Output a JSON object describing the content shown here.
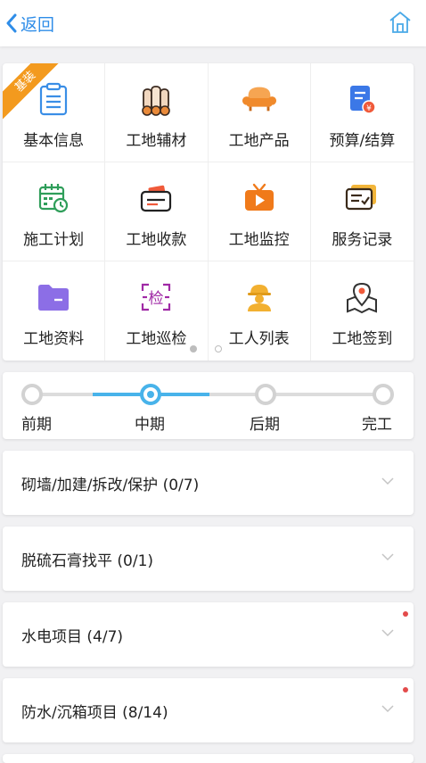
{
  "header": {
    "back_label": "返回"
  },
  "grid": {
    "badge": "基装",
    "items": [
      {
        "label": "基本信息",
        "icon": "document-list-icon"
      },
      {
        "label": "工地辅材",
        "icon": "material-rolls-icon"
      },
      {
        "label": "工地产品",
        "icon": "sofa-icon"
      },
      {
        "label": "预算/结算",
        "icon": "budget-icon"
      },
      {
        "label": "施工计划",
        "icon": "calendar-clock-icon"
      },
      {
        "label": "工地收款",
        "icon": "wallet-icon"
      },
      {
        "label": "工地监控",
        "icon": "tv-play-icon"
      },
      {
        "label": "服务记录",
        "icon": "record-cards-icon"
      },
      {
        "label": "工地资料",
        "icon": "folder-icon"
      },
      {
        "label": "工地巡检",
        "icon": "inspection-icon",
        "glyph": "检"
      },
      {
        "label": "工人列表",
        "icon": "worker-icon"
      },
      {
        "label": "工地签到",
        "icon": "map-pin-icon"
      }
    ]
  },
  "stages": {
    "current_index": 1,
    "items": [
      {
        "label": "前期"
      },
      {
        "label": "中期"
      },
      {
        "label": "后期"
      },
      {
        "label": "完工"
      }
    ]
  },
  "sections": [
    {
      "title": "砌墙/加建/拆改/保护 (0/7)",
      "has_dot": false
    },
    {
      "title": "脱硫石膏找平 (0/1)",
      "has_dot": false
    },
    {
      "title": "水电项目 (4/7)",
      "has_dot": true
    },
    {
      "title": "防水/沉箱项目 (8/14)",
      "has_dot": true
    }
  ],
  "colors": {
    "accent": "#2f8de8",
    "progress": "#48b3ea",
    "badge": "#f39a1e",
    "alert_dot": "#e34b4b"
  }
}
